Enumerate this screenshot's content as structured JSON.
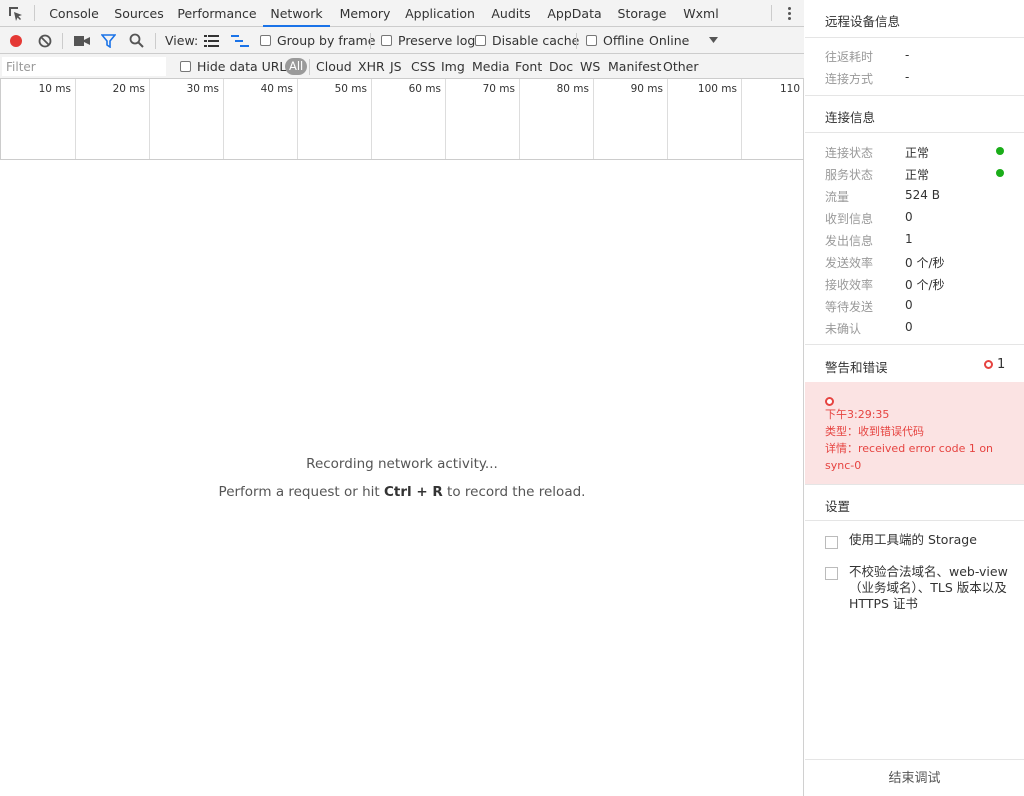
{
  "tabs": [
    "Console",
    "Sources",
    "Performance",
    "Network",
    "Memory",
    "Application",
    "Audits",
    "AppData",
    "Storage",
    "Wxml"
  ],
  "active_tab": "Network",
  "toolbar": {
    "view_label": "View:",
    "group_by_frame": "Group by frame",
    "preserve_log": "Preserve log",
    "disable_cache": "Disable cache",
    "offline": "Offline",
    "throttle": "Online"
  },
  "filterbar": {
    "placeholder": "Filter",
    "hide_data_urls": "Hide data URLs",
    "types": [
      "All",
      "Cloud",
      "XHR",
      "JS",
      "CSS",
      "Img",
      "Media",
      "Font",
      "Doc",
      "WS",
      "Manifest",
      "Other"
    ]
  },
  "timeline": {
    "ticks": [
      "10 ms",
      "20 ms",
      "30 ms",
      "40 ms",
      "50 ms",
      "60 ms",
      "70 ms",
      "80 ms",
      "90 ms",
      "100 ms",
      "110"
    ]
  },
  "empty": {
    "line1": "Recording network activity...",
    "line2_prefix": "Perform a request or hit ",
    "line2_key": "Ctrl + R",
    "line2_suffix": " to record the reload."
  },
  "side": {
    "remote_title": "远程设备信息",
    "remote_rows": [
      {
        "label": "往返耗时",
        "value": "-"
      },
      {
        "label": "连接方式",
        "value": "-"
      }
    ],
    "conn_title": "连接信息",
    "conn_rows": [
      {
        "label": "连接状态",
        "value": "正常",
        "status": "ok"
      },
      {
        "label": "服务状态",
        "value": "正常",
        "status": "ok"
      },
      {
        "label": "流量",
        "value": "524 B"
      },
      {
        "label": "收到信息",
        "value": "0"
      },
      {
        "label": "发出信息",
        "value": "1"
      },
      {
        "label": "发送效率",
        "value": "0 个/秒"
      },
      {
        "label": "接收效率",
        "value": "0 个/秒"
      },
      {
        "label": "等待发送",
        "value": "0"
      },
      {
        "label": "未确认",
        "value": "0"
      }
    ],
    "warn_title": "警告和错误",
    "warn_count": "1",
    "error": {
      "time": "下午3:29:35",
      "type": "类型：收到错误代码",
      "detail": "详情：received error code 1 on sync-0"
    },
    "settings_title": "设置",
    "settings": [
      "使用工具端的 Storage",
      "不校验合法域名、web-view（业务域名）、TLS 版本以及 HTTPS 证书"
    ],
    "end_button": "结束调试"
  },
  "colors": {
    "accent": "#1a73e8",
    "record_red": "#e53935",
    "ok_green": "#1aad19",
    "error_red": "#e64340",
    "error_bg": "#fbe3e3"
  }
}
